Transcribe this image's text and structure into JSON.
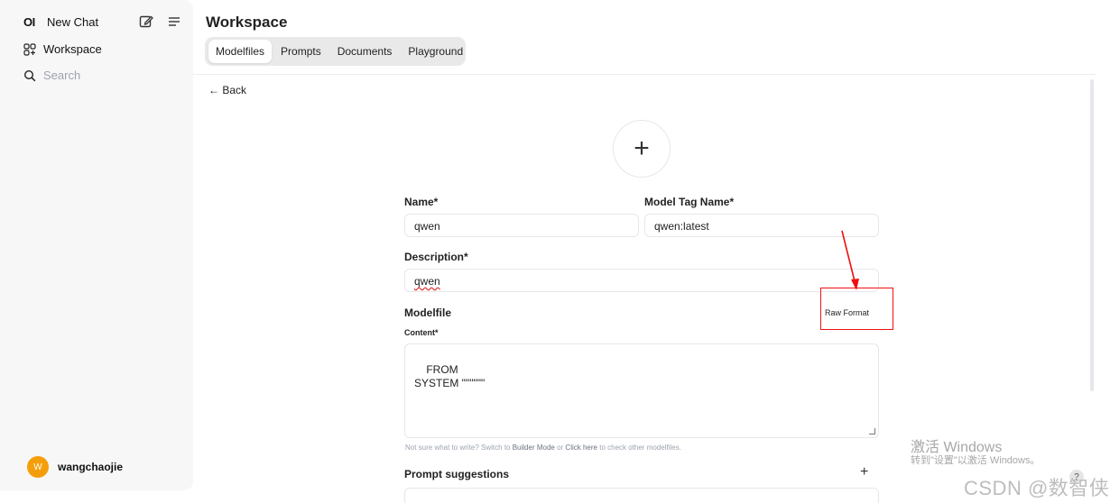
{
  "sidebar": {
    "logo": "OI",
    "new_chat": "New Chat",
    "workspace": "Workspace",
    "search_placeholder": "Search",
    "user": {
      "initial": "W",
      "name": "wangchaojie",
      "avatar_color": "#f59e0b"
    }
  },
  "header": {
    "title": "Workspace",
    "tabs": [
      {
        "label": "Modelfiles",
        "active": true
      },
      {
        "label": "Prompts"
      },
      {
        "label": "Documents"
      },
      {
        "label": "Playground"
      }
    ]
  },
  "back": "← Back",
  "form": {
    "upload_symbol": "+",
    "name_label": "Name*",
    "name_value": "qwen",
    "tag_label": "Model Tag Name*",
    "tag_value": "qwen:latest",
    "description_label": "Description*",
    "description_value": "qwen",
    "modelfile_label": "Modelfile",
    "raw_format": "Raw Format",
    "content_label": "Content*",
    "content_value": "FROM\nSYSTEM \"\"\"\"\"\"",
    "hint": {
      "prefix": "Not sure what to write? Switch to ",
      "builder": "Builder Mode",
      "mid": " or ",
      "click": "Click here",
      "suffix": " to check other modelfiles."
    },
    "prompt_suggestions_label": "Prompt suggestions",
    "add_symbol": "+"
  },
  "annotation_color": "#ee1111",
  "watermarks": {
    "activate_title": "激活 Windows",
    "activate_sub": "转到\"设置\"以激活 Windows。",
    "csdn": "CSDN @数智侠",
    "help": "?"
  }
}
